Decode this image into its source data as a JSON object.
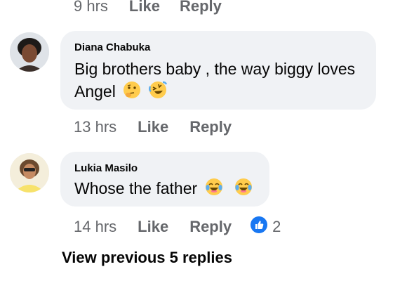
{
  "top_meta": {
    "time": "9 hrs",
    "like": "Like",
    "reply": "Reply"
  },
  "comments": [
    {
      "author": "Diana Chabuka",
      "text_line1": "Big brothers baby , the way biggy loves",
      "text_line2": "Angel",
      "emojis": [
        "thinking-face-icon",
        "rolling-laughing-icon"
      ],
      "time": "13 hrs",
      "like": "Like",
      "reply": "Reply"
    },
    {
      "author": "Lukia Masilo",
      "text": "Whose the father",
      "emojis": [
        "tears-of-joy-icon",
        "tears-of-joy-icon"
      ],
      "time": "14 hrs",
      "like": "Like",
      "reply": "Reply",
      "reaction_icon": "like-reaction-icon",
      "reaction_count": "2"
    }
  ],
  "view_previous": "View previous 5 replies",
  "colors": {
    "bubble": "#f0f2f5",
    "meta_text": "#65676b",
    "text": "#050505",
    "like_blue": "#1877f2",
    "emoji_yellow": "#ffcc4d"
  }
}
